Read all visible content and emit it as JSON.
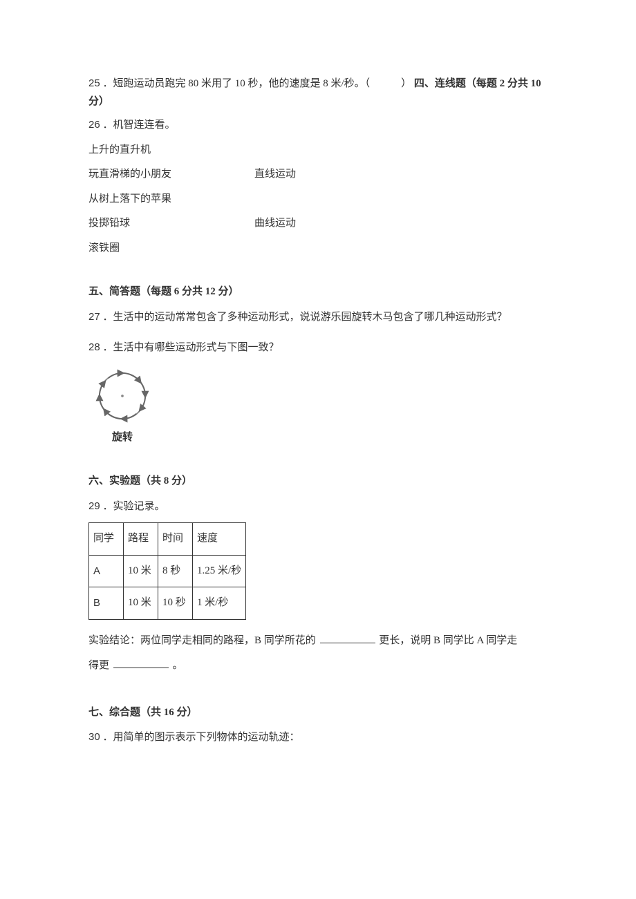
{
  "q25": {
    "num": "25",
    "text": "．短跑运动员跑完 80 米用了 10 秒，他的速度是 8 米/秒。（　　　）",
    "section_inline": "四、连线题（每题 2 分共 10 分）"
  },
  "q26": {
    "num": "26",
    "lead": "．机智连连看。",
    "items_left": [
      "上升的直升机",
      "玩直滑梯的小朋友",
      "从树上落下的苹果",
      "投掷铅球",
      "滚铁圈"
    ],
    "items_right_row2": "直线运动",
    "items_right_row4": "曲线运动"
  },
  "sec5": {
    "title": "五、简答题（每题 6 分共 12 分）"
  },
  "q27": {
    "num": "27",
    "text": "．生活中的运动常常包含了多种运动形式，说说游乐园旋转木马包含了哪几种运动形式？"
  },
  "q28": {
    "num": "28",
    "text": "．生活中有哪些运动形式与下图一致？",
    "diagram_label": "旋转"
  },
  "sec6": {
    "title": "六、实验题（共 8 分）"
  },
  "q29": {
    "num": "29",
    "lead": "．实验记录。",
    "headers": [
      "同学",
      "路程",
      "时间",
      "速度"
    ],
    "rows": [
      [
        "A",
        "10 米",
        "8 秒",
        "1.25 米/秒"
      ],
      [
        "B",
        "10 米",
        "10 秒",
        "1 米/秒"
      ]
    ],
    "conclusion_a": "实验结论：两位同学走相同的路程，B 同学所花的",
    "conclusion_b": "更长，说明 B 同学比 A 同学走",
    "conclusion_c": "得更",
    "conclusion_end": "。"
  },
  "sec7": {
    "title": "七、综合题（共 16 分）"
  },
  "q30": {
    "num": "30",
    "text": "．用简单的图示表示下列物体的运动轨迹："
  }
}
